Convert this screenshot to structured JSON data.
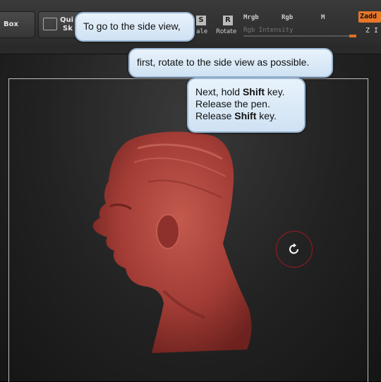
{
  "toolbar": {
    "left_button_label": "Box",
    "quick_sketch_label_1": "Qui",
    "quick_sketch_label_2": "Sk",
    "scale_icon_letter": "S",
    "scale_label": "ale",
    "rotate_icon_letter": "R",
    "rotate_label": "Rotate",
    "mrgb_label": "Mrgb",
    "rgb_label": "Rgb",
    "m_label": "M",
    "rgb_intensity_label": "Rgb Intensity",
    "zadd_label": "Zadd",
    "z_intensity_label": "Z I"
  },
  "callouts": {
    "step1": "To go to the side view,",
    "step2": "first, rotate to the side view as possible.",
    "step3_line1_pre": "Next, hold ",
    "step3_line1_key": "Shift",
    "step3_line1_post": " key.",
    "step3_line2": "Release the pen.",
    "step3_line3_pre": "Release ",
    "step3_line3_key": "Shift",
    "step3_line3_post": " key."
  },
  "colors": {
    "callout_bg": "#dbe9f6",
    "zadd_accent": "#e8772a",
    "model_clay": "#a8413a",
    "rotate_cursor_ring": "#9a1a22"
  },
  "icons": [
    "quick-sketch-icon",
    "scale-icon",
    "rotate-icon",
    "rotate-cursor-icon"
  ]
}
